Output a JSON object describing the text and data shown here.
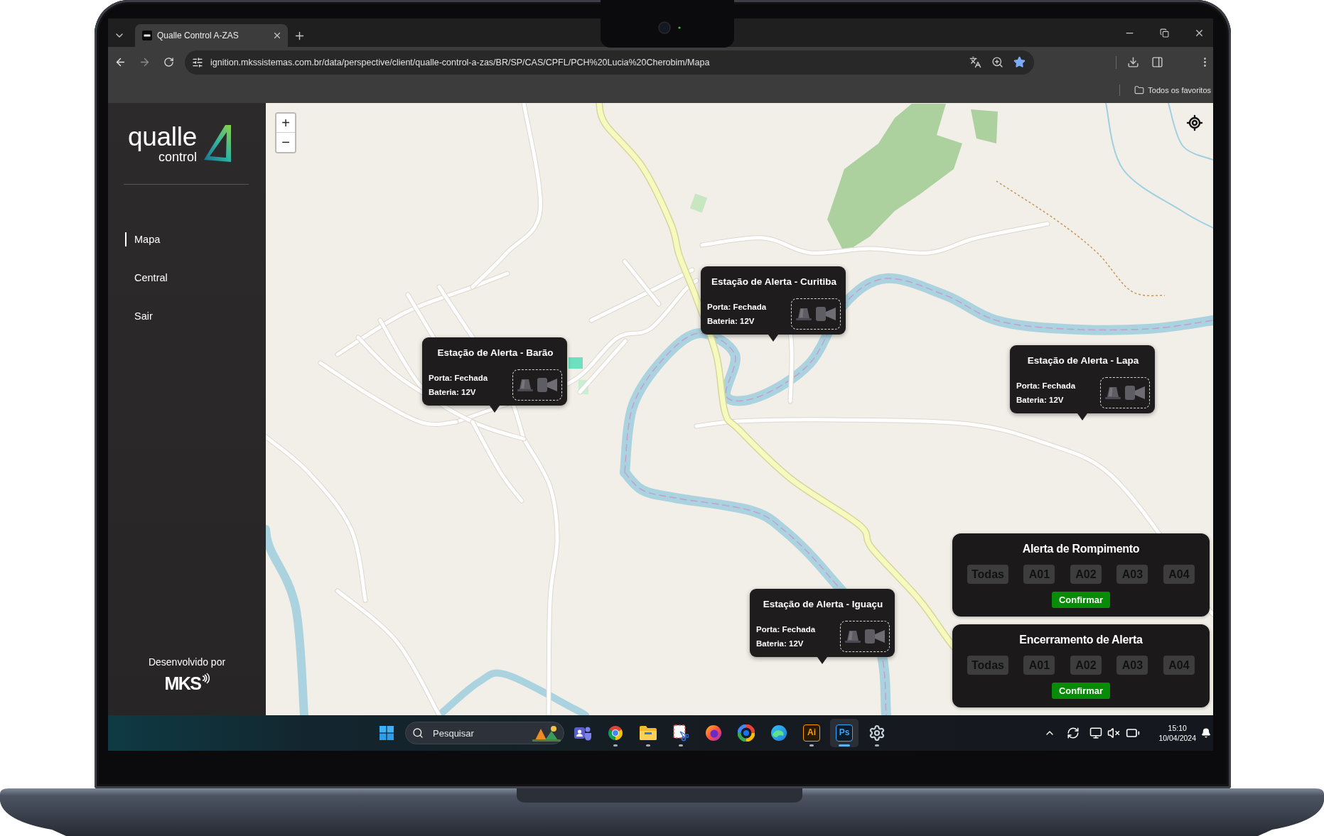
{
  "browser": {
    "tabs": [
      {
        "title": "Qualle Control A-ZAS",
        "selected": true
      }
    ],
    "address": "ignition.mkssistemas.com.br/data/perspective/client/qualle-control-a-zas/BR/SP/CAS/CPFL/PCH%20Lucia%20Cherobim/Mapa",
    "bookmarks_bar": {
      "all_bookmarks": "Todos os favoritos"
    }
  },
  "sidebar": {
    "logo": {
      "name": "qualle",
      "tagline": "control"
    },
    "items": [
      {
        "label": "Mapa",
        "selected": true
      },
      {
        "label": "Central",
        "selected": false
      },
      {
        "label": "Sair",
        "selected": false
      }
    ],
    "footer": {
      "label": "Desenvolvido por",
      "brand": "MKS"
    }
  },
  "map": {
    "zoom_controls": [
      "+",
      "−"
    ],
    "stations": [
      {
        "title": "Estação de Alerta - Curitiba",
        "door": "Porta: Fechada",
        "battery": "Bateria: 12V"
      },
      {
        "title": "Estação de Alerta - Barão",
        "door": "Porta: Fechada",
        "battery": "Bateria: 12V"
      },
      {
        "title": "Estação de Alerta - Lapa",
        "door": "Porta: Fechada",
        "battery": "Bateria: 12V"
      },
      {
        "title": "Estação de Alerta - Iguaçu",
        "door": "Porta: Fechada",
        "battery": "Bateria: 12V"
      }
    ]
  },
  "alert_panels": [
    {
      "title": "Alerta de Rompimento",
      "options": [
        {
          "label": "Todas",
          "selected": false
        },
        {
          "label": "A01",
          "selected": false
        },
        {
          "label": "A02",
          "selected": false
        },
        {
          "label": "A03",
          "selected": false
        },
        {
          "label": "A04",
          "selected": false
        }
      ],
      "confirm": "Confirmar"
    },
    {
      "title": "Encerramento de Alerta",
      "options": [
        {
          "label": "Todas",
          "selected": false
        },
        {
          "label": "A01",
          "selected": false
        },
        {
          "label": "A02",
          "selected": false
        },
        {
          "label": "A03",
          "selected": false
        },
        {
          "label": "A04",
          "selected": false
        }
      ],
      "confirm": "Confirmar"
    }
  ],
  "taskbar": {
    "search": {
      "placeholder": "Pesquisar"
    },
    "apps": [
      {
        "kind": "people",
        "running": false,
        "selected": false
      },
      {
        "kind": "browser",
        "running": true,
        "selected": false
      },
      {
        "kind": "folder",
        "running": true,
        "selected": false
      },
      {
        "kind": "snip",
        "running": true,
        "selected": false
      },
      {
        "kind": "fox",
        "running": false,
        "selected": false
      },
      {
        "kind": "swirl",
        "running": false,
        "selected": false
      },
      {
        "kind": "wave",
        "running": false,
        "selected": false
      },
      {
        "kind": "lettered",
        "label": "Ai",
        "color": "#ff9a00",
        "running": true,
        "selected": false
      },
      {
        "kind": "lettered",
        "label": "Ps",
        "color": "#31a8ff",
        "running": true,
        "selected": true
      },
      {
        "kind": "gear",
        "running": true,
        "selected": false
      }
    ],
    "clock": {
      "time": "15:10",
      "date": "10/04/2024"
    }
  }
}
